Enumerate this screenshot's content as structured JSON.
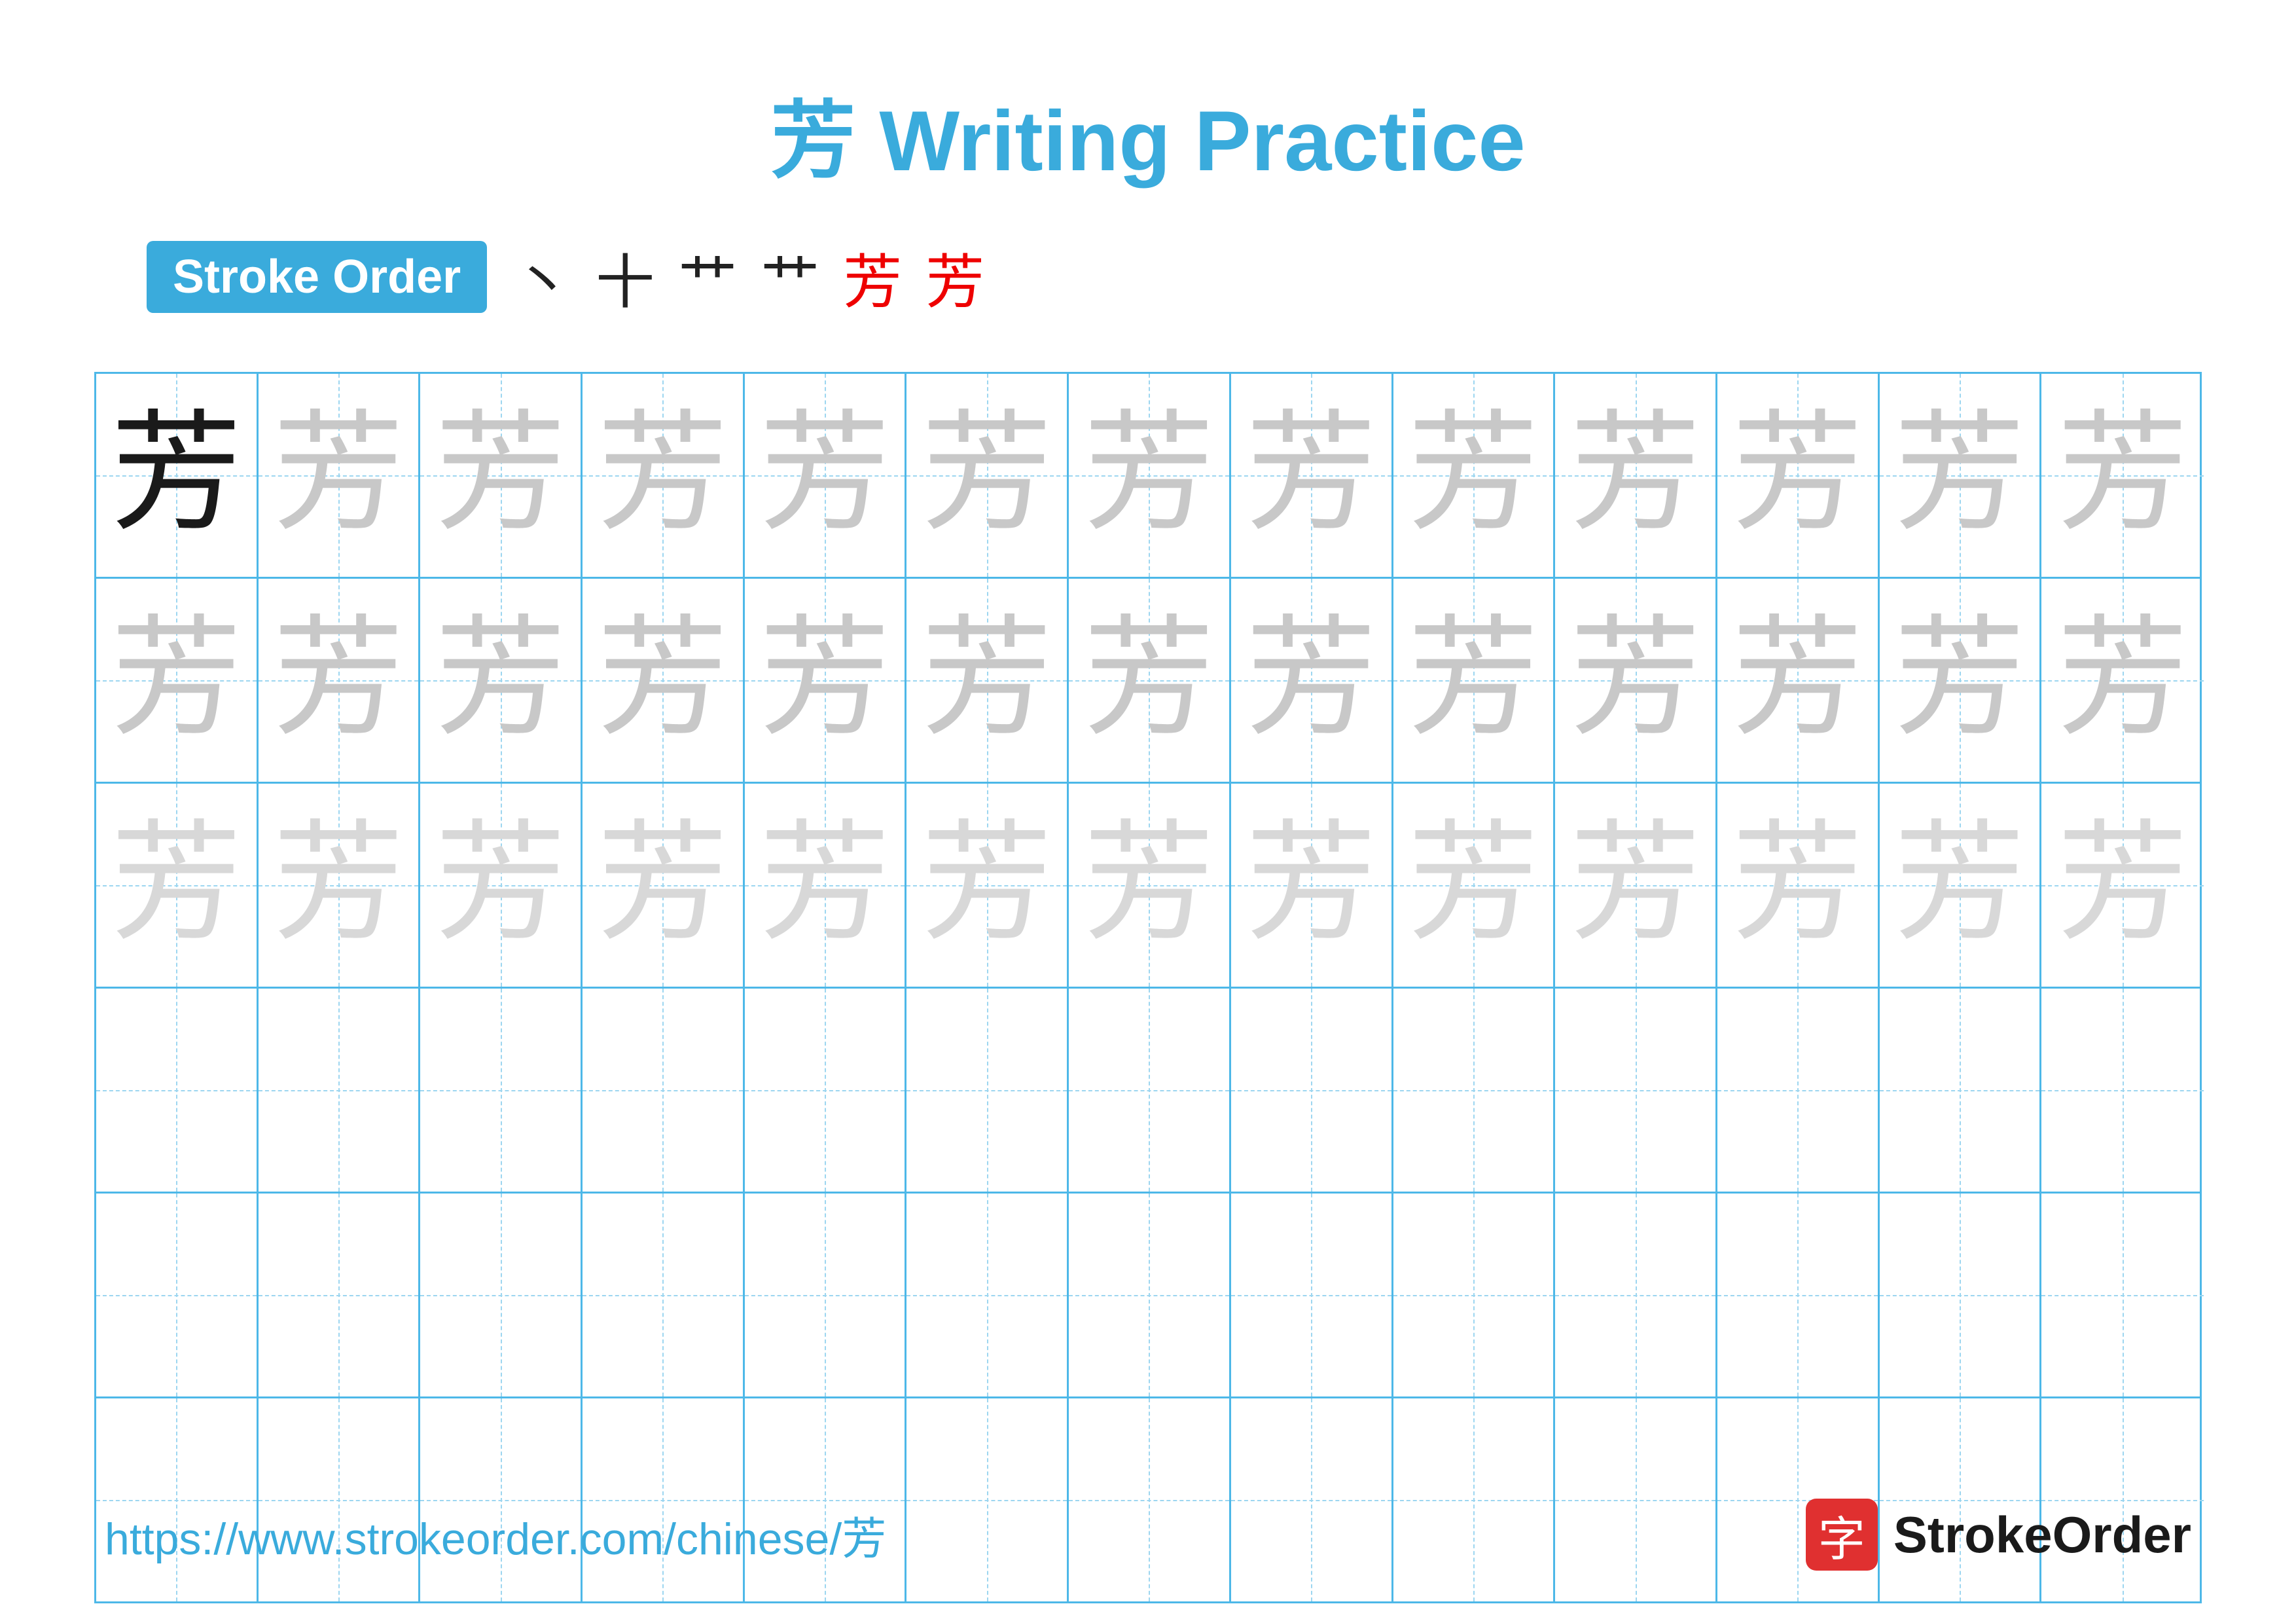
{
  "title": "芳 Writing Practice",
  "stroke_order": {
    "label": "Stroke Order",
    "strokes": [
      "丶",
      "十",
      "艹",
      "艹艹",
      "芳",
      "芳"
    ]
  },
  "grid": {
    "rows": 6,
    "cols": 13,
    "char": "芳",
    "row_styles": [
      "dark+medium",
      "medium",
      "light",
      "empty",
      "empty",
      "empty"
    ]
  },
  "footer": {
    "url": "https://www.strokeorder.com/chinese/芳",
    "logo_char": "字",
    "logo_text": "StrokeOrder"
  }
}
